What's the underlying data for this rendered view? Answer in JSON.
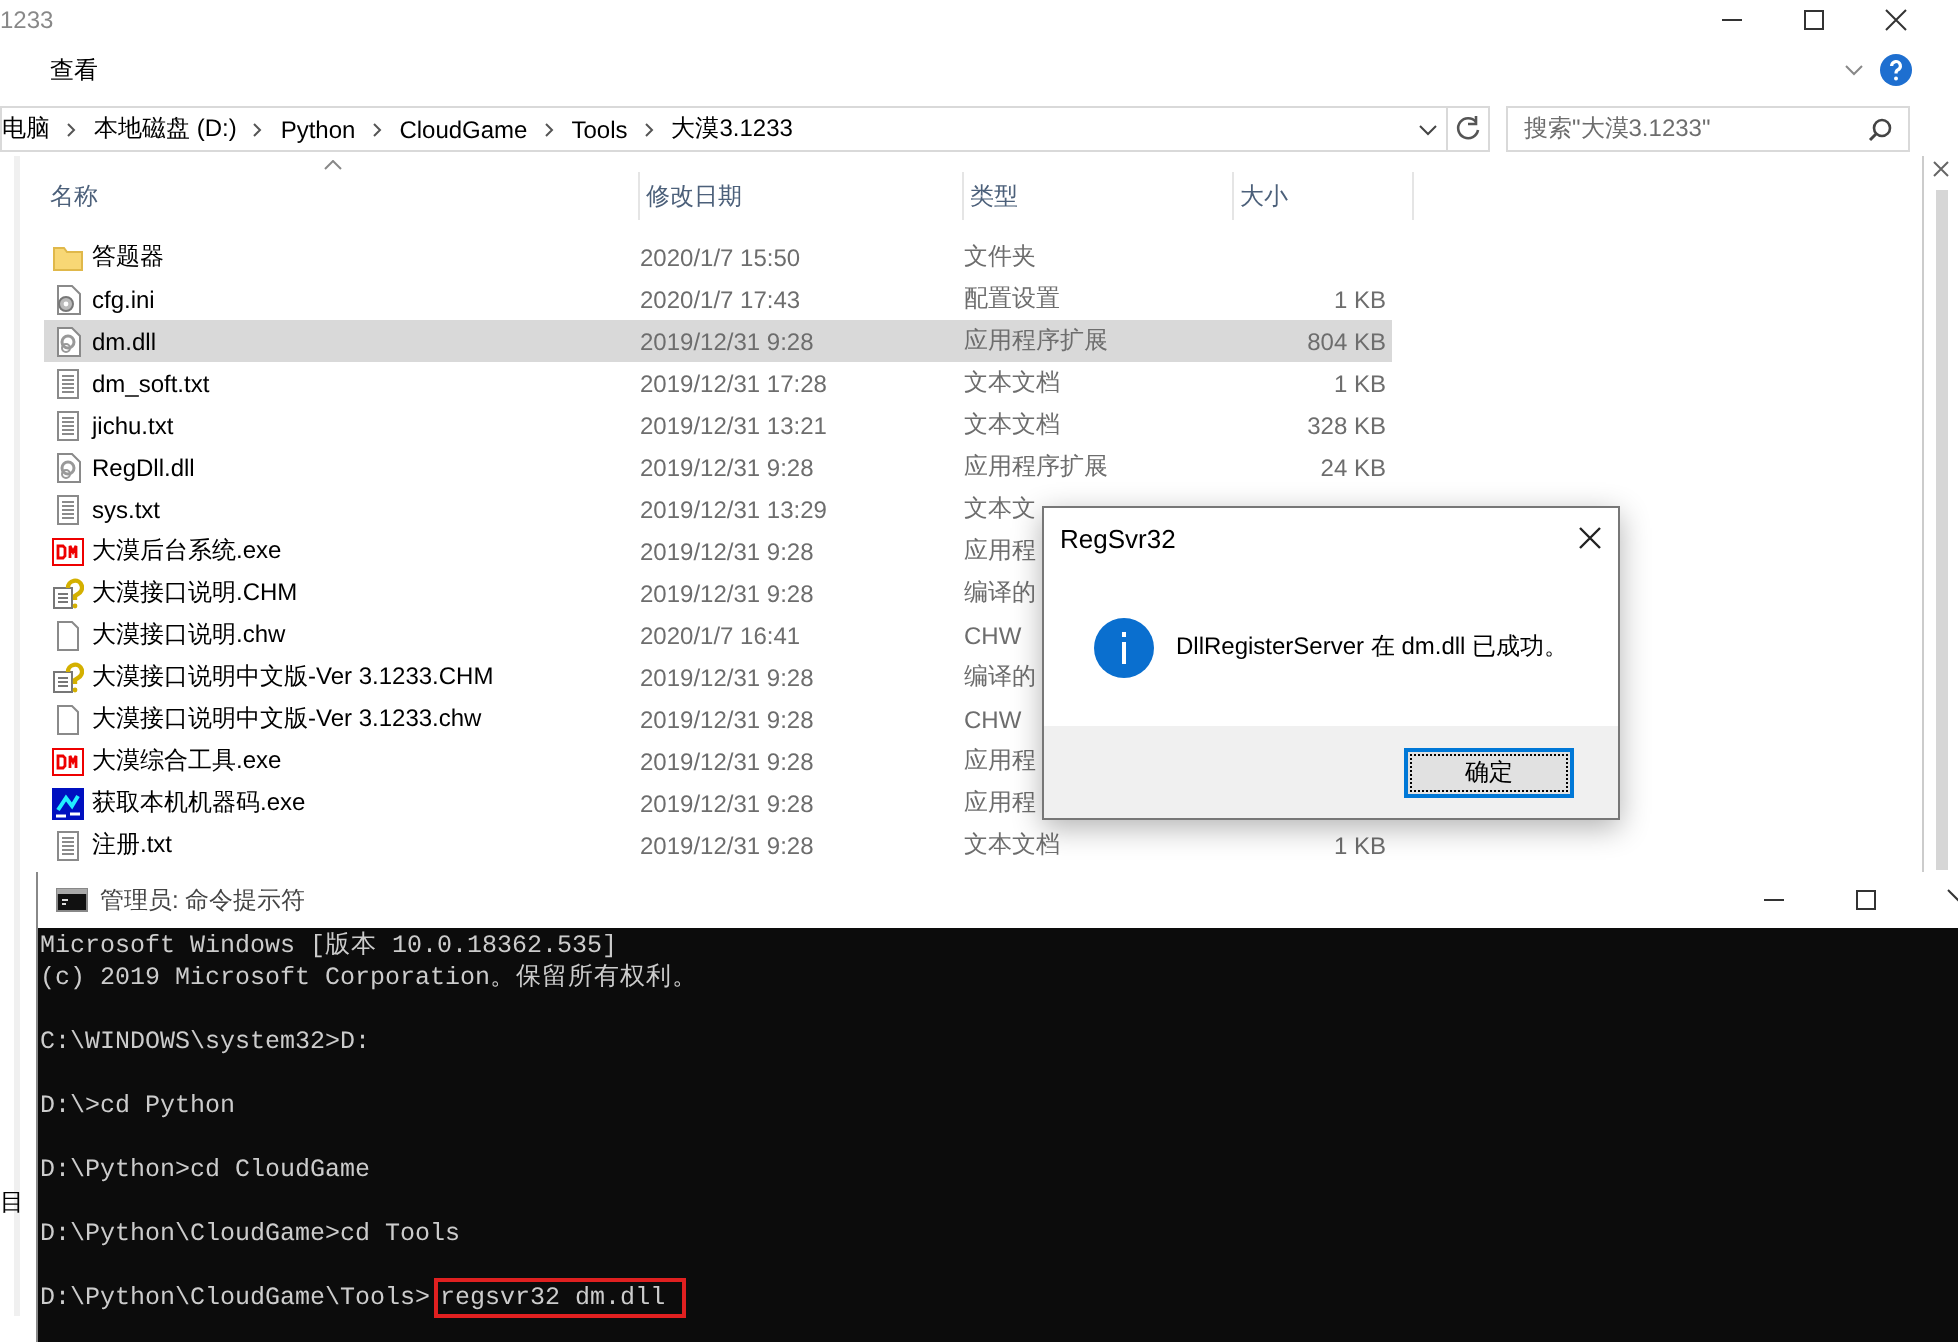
{
  "explorer": {
    "title": "1233",
    "ribbon_tab": "查看",
    "breadcrumb": [
      "电脑",
      "本地磁盘 (D:)",
      "Python",
      "CloudGame",
      "Tools",
      "大漠3.1233"
    ],
    "search": {
      "placeholder": "搜索\"大漠3.1233\""
    },
    "columns": [
      "名称",
      "修改日期",
      "类型",
      "大小"
    ],
    "files": [
      {
        "name": "答题器",
        "kind": "folder",
        "modified": "2020/1/7 15:50",
        "type": "文件夹",
        "selected": false
      },
      {
        "name": "cfg.ini",
        "kind": "config",
        "modified": "2020/1/7 17:43",
        "type": "配置设置",
        "size": "1 KB",
        "selected": false
      },
      {
        "name": "dm.dll",
        "kind": "dll",
        "modified": "2019/12/31 9:28",
        "type": "应用程序扩展",
        "size": "804 KB",
        "selected": true
      },
      {
        "name": "dm_soft.txt",
        "kind": "text",
        "modified": "2019/12/31 17:28",
        "type": "文本文档",
        "size": "1 KB",
        "selected": false
      },
      {
        "name": "jichu.txt",
        "kind": "text",
        "modified": "2019/12/31 13:21",
        "type": "文本文档",
        "size": "328 KB",
        "selected": false
      },
      {
        "name": "RegDll.dll",
        "kind": "dll",
        "modified": "2019/12/31 9:28",
        "type": "应用程序扩展",
        "size": "24 KB",
        "selected": false
      },
      {
        "name": "sys.txt",
        "kind": "text",
        "modified": "2019/12/31 13:29",
        "type": "文本文",
        "selected": false
      },
      {
        "name": "大漠后台系统.exe",
        "kind": "dm",
        "modified": "2019/12/31 9:28",
        "type": "应用程",
        "selected": false
      },
      {
        "name": "大漠接口说明.CHM",
        "kind": "chm",
        "modified": "2019/12/31 9:28",
        "type": "编译的",
        "selected": false
      },
      {
        "name": "大漠接口说明.chw",
        "kind": "blank",
        "modified": "2020/1/7 16:41",
        "type": "CHW",
        "selected": false
      },
      {
        "name": "大漠接口说明中文版-Ver 3.1233.CHM",
        "kind": "chm",
        "modified": "2019/12/31 9:28",
        "type": "编译的",
        "selected": false
      },
      {
        "name": "大漠接口说明中文版-Ver 3.1233.chw",
        "kind": "blank",
        "modified": "2019/12/31 9:28",
        "type": "CHW",
        "selected": false
      },
      {
        "name": "大漠综合工具.exe",
        "kind": "dm",
        "modified": "2019/12/31 9:28",
        "type": "应用程",
        "selected": false
      },
      {
        "name": "获取本机机器码.exe",
        "kind": "app",
        "modified": "2019/12/31 9:28",
        "type": "应用程",
        "selected": false
      },
      {
        "name": "注册.txt",
        "kind": "text",
        "modified": "2019/12/31 9:28",
        "type": "文本文档",
        "size": "1 KB",
        "selected": false
      }
    ],
    "nav_fragment": "目"
  },
  "dialog": {
    "title": "RegSvr32",
    "message": "DllRegisterServer 在 dm.dll 已成功。",
    "button": "确定"
  },
  "console": {
    "title": "管理员: 命令提示符",
    "lines": [
      {
        "kind": "banner",
        "text": "Microsoft Windows [版本 10.0.18362.535]"
      },
      {
        "kind": "banner",
        "text": "(c) 2019 Microsoft Corporation。保留所有权利。"
      },
      {
        "kind": "prompt",
        "prompt": "C:\\WINDOWS\\system32>",
        "command": "D:"
      },
      {
        "kind": "prompt",
        "prompt": "D:\\>",
        "command": "cd Python"
      },
      {
        "kind": "prompt",
        "prompt": "D:\\Python>",
        "command": "cd CloudGame"
      },
      {
        "kind": "prompt",
        "prompt": "D:\\Python\\CloudGame>",
        "command": "cd Tools"
      },
      {
        "kind": "prompt",
        "prompt": "D:\\Python\\CloudGame\\Tools>",
        "command": "regsvr32 dm.dll",
        "highlighted": true
      }
    ]
  }
}
